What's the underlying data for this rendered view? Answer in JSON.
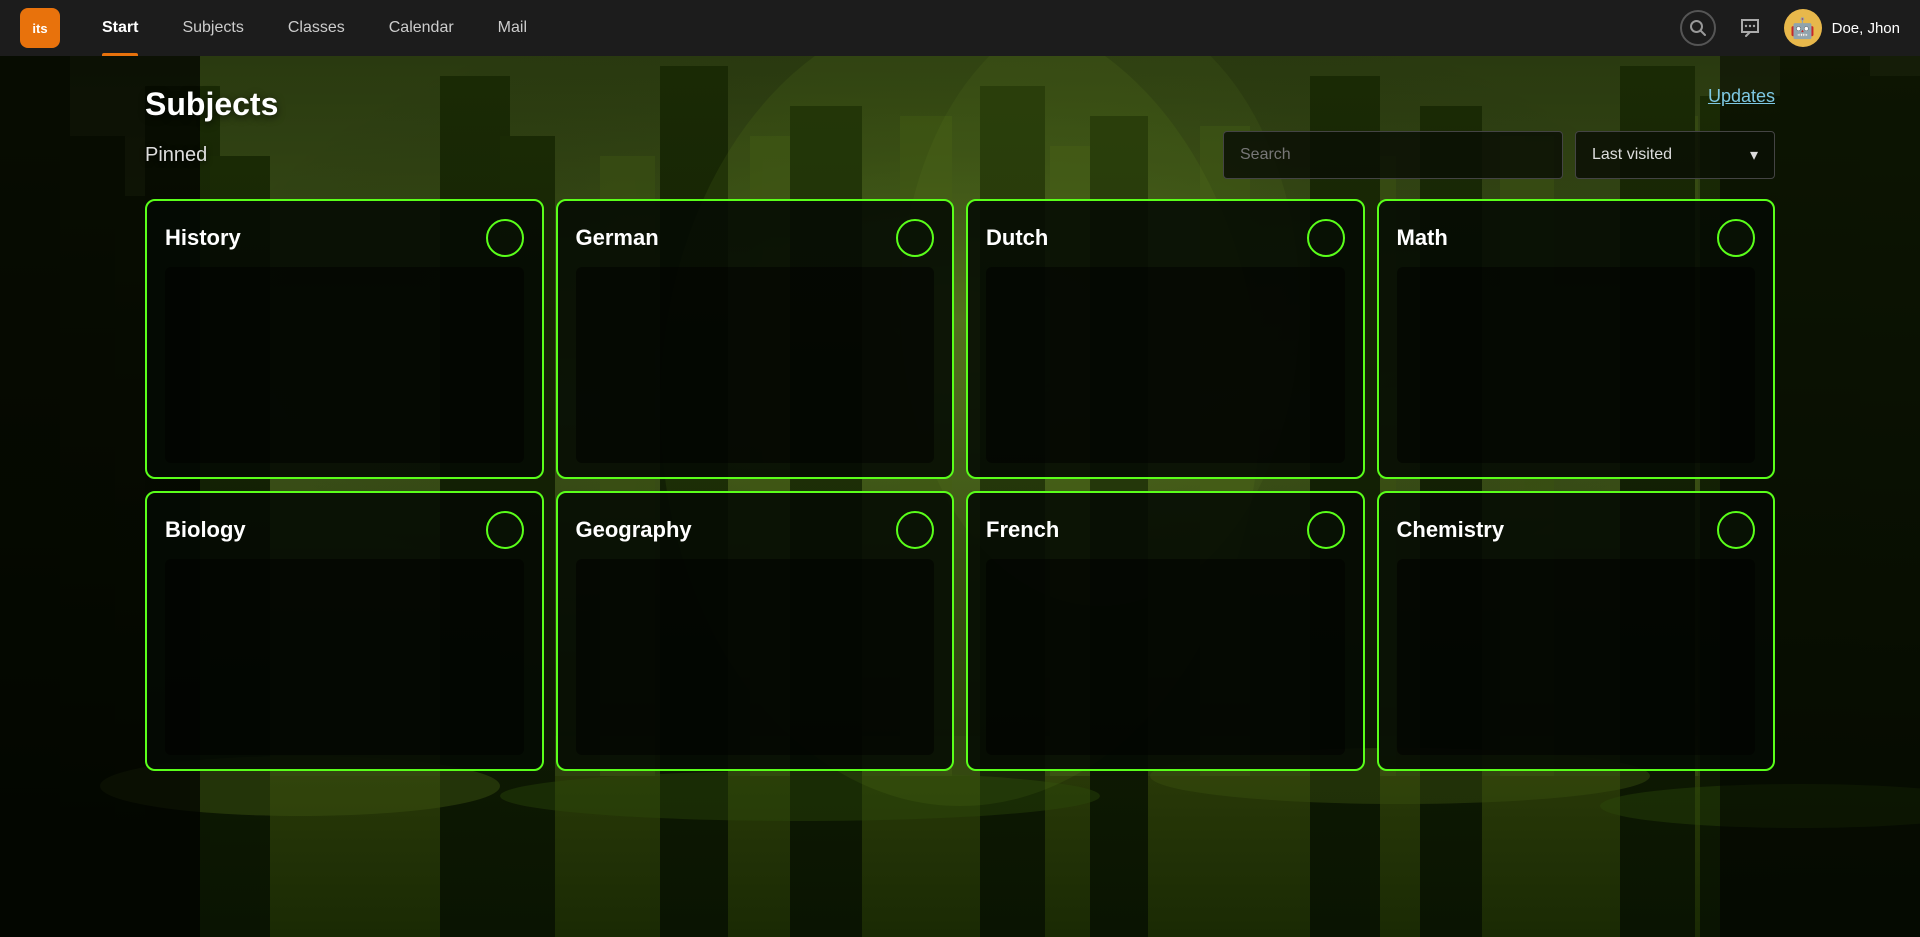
{
  "app": {
    "logo_text": "its",
    "logo_bg": "#e8720c"
  },
  "navbar": {
    "items": [
      {
        "id": "start",
        "label": "Start",
        "active": true
      },
      {
        "id": "subjects",
        "label": "Subjects",
        "active": false
      },
      {
        "id": "classes",
        "label": "Classes",
        "active": false
      },
      {
        "id": "calendar",
        "label": "Calendar",
        "active": false
      },
      {
        "id": "mail",
        "label": "Mail",
        "active": false
      }
    ],
    "user_name": "Doe, Jhon",
    "avatar_emoji": "🤖"
  },
  "page": {
    "title": "Subjects",
    "updates_label": "Updates",
    "pinned_label": "Pinned",
    "search_placeholder": "Search",
    "last_visited_label": "Last visited"
  },
  "subjects": [
    {
      "id": "history",
      "name": "History",
      "row": 1,
      "col": 1
    },
    {
      "id": "german",
      "name": "German",
      "row": 1,
      "col": 2
    },
    {
      "id": "dutch",
      "name": "Dutch",
      "row": 1,
      "col": 3
    },
    {
      "id": "math",
      "name": "Math",
      "row": 1,
      "col": 4
    },
    {
      "id": "biology",
      "name": "Biology",
      "row": 2,
      "col": 1
    },
    {
      "id": "geography",
      "name": "Geography",
      "row": 2,
      "col": 2
    },
    {
      "id": "french",
      "name": "French",
      "row": 2,
      "col": 3
    },
    {
      "id": "chemistry",
      "name": "Chemistry",
      "row": 2,
      "col": 4
    }
  ]
}
